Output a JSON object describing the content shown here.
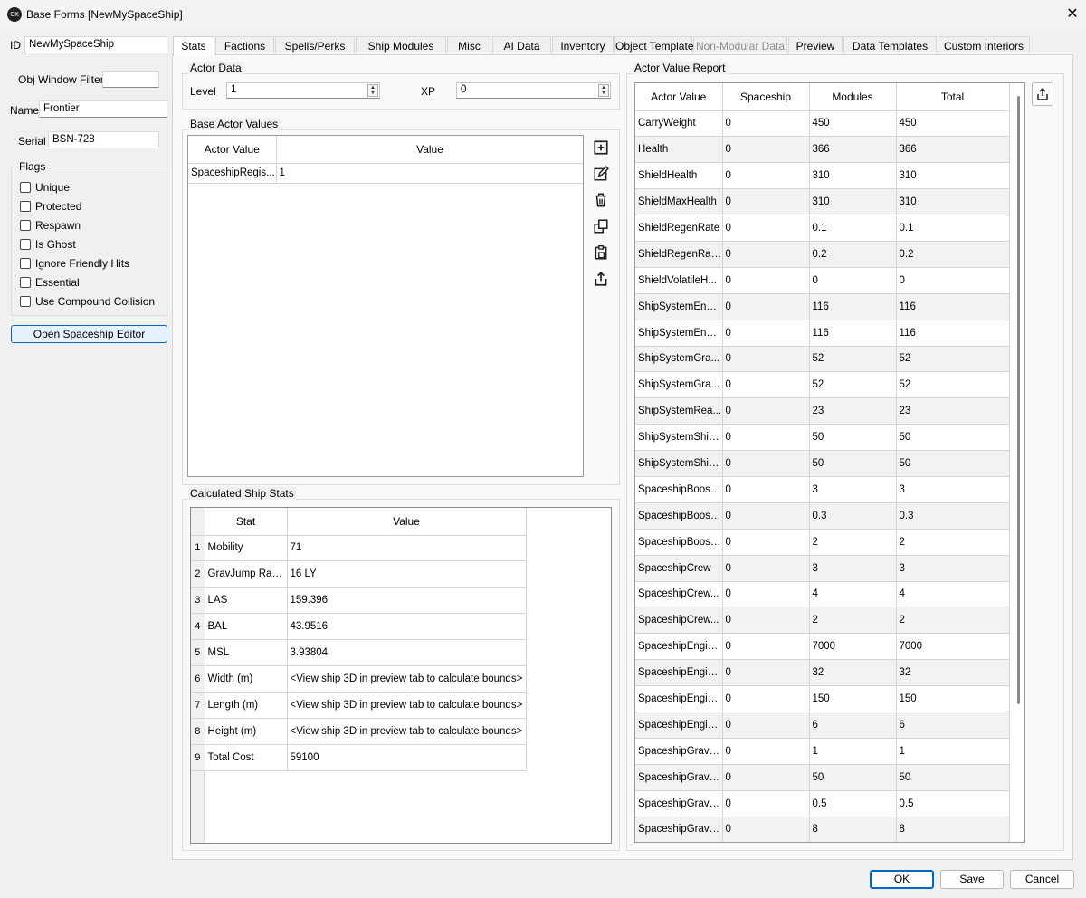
{
  "window": {
    "title": "Base Forms [NewMySpaceShip]",
    "app_icon": "CK",
    "close_glyph": "✕"
  },
  "left": {
    "id_label": "ID",
    "id_value": "NewMySpaceShip",
    "filter_label": "Obj Window Filter",
    "filter_value": "",
    "name_label": "Name",
    "name_value": "Frontier",
    "serial_label": "Serial",
    "serial_value": "BSN-728",
    "flags_title": "Flags",
    "flags": [
      {
        "label": "Unique",
        "checked": false
      },
      {
        "label": "Protected",
        "checked": false
      },
      {
        "label": "Respawn",
        "checked": false
      },
      {
        "label": "Is Ghost",
        "checked": false
      },
      {
        "label": "Ignore Friendly Hits",
        "checked": false
      },
      {
        "label": "Essential",
        "checked": false
      },
      {
        "label": "Use Compound Collision",
        "checked": false
      }
    ],
    "editor_button": "Open Spaceship Editor"
  },
  "tabs": [
    {
      "label": "Stats",
      "state": "active"
    },
    {
      "label": "Factions",
      "state": "normal"
    },
    {
      "label": "Spells/Perks",
      "state": "normal"
    },
    {
      "label": "Ship Modules",
      "state": "normal"
    },
    {
      "label": "Misc",
      "state": "normal"
    },
    {
      "label": "AI Data",
      "state": "normal"
    },
    {
      "label": "Inventory",
      "state": "normal"
    },
    {
      "label": "Object Template",
      "state": "normal"
    },
    {
      "label": "Non-Modular Data",
      "state": "disabled"
    },
    {
      "label": "Preview",
      "state": "normal"
    },
    {
      "label": "Data Templates",
      "state": "normal"
    },
    {
      "label": "Custom Interiors",
      "state": "normal"
    }
  ],
  "actor_data": {
    "title": "Actor Data",
    "level_label": "Level",
    "level_value": "1",
    "xp_label": "XP",
    "xp_value": "0"
  },
  "base_actor_values": {
    "title": "Base Actor Values",
    "columns": [
      "Actor Value",
      "Value"
    ],
    "rows": [
      {
        "actor_value": "SpaceshipRegis...",
        "value": "1"
      }
    ],
    "toolbar_icons": [
      "add-icon",
      "edit-icon",
      "delete-icon",
      "duplicate-icon",
      "paste-icon",
      "export-icon"
    ]
  },
  "calculated_ship_stats": {
    "title": "Calculated Ship Stats",
    "columns": [
      "Stat",
      "Value"
    ],
    "rows": [
      {
        "n": "1",
        "stat": "Mobility",
        "value": "71"
      },
      {
        "n": "2",
        "stat": "GravJump Range",
        "value": "16 LY"
      },
      {
        "n": "3",
        "stat": "LAS",
        "value": "159.396"
      },
      {
        "n": "4",
        "stat": "BAL",
        "value": "43.9516"
      },
      {
        "n": "5",
        "stat": "MSL",
        "value": "3.93804"
      },
      {
        "n": "6",
        "stat": "Width (m)",
        "value": "<View ship 3D in preview tab to calculate bounds>"
      },
      {
        "n": "7",
        "stat": "Length (m)",
        "value": "<View ship 3D in preview tab to calculate bounds>"
      },
      {
        "n": "8",
        "stat": "Height (m)",
        "value": "<View ship 3D in preview tab to calculate bounds>"
      },
      {
        "n": "9",
        "stat": "Total Cost",
        "value": "59100"
      }
    ]
  },
  "actor_value_report": {
    "title": "Actor Value Report",
    "columns": [
      "Actor Value",
      "Spaceship",
      "Modules",
      "Total"
    ],
    "rows": [
      [
        "CarryWeight",
        "0",
        "450",
        "450"
      ],
      [
        "Health",
        "0",
        "366",
        "366"
      ],
      [
        "ShieldHealth",
        "0",
        "310",
        "310"
      ],
      [
        "ShieldMaxHealth",
        "0",
        "310",
        "310"
      ],
      [
        "ShieldRegenRate",
        "0",
        "0.1",
        "0.1"
      ],
      [
        "ShieldRegenRat...",
        "0",
        "0.2",
        "0.2"
      ],
      [
        "ShieldVolatileH...",
        "0",
        "0",
        "0"
      ],
      [
        "ShipSystemEngi...",
        "0",
        "116",
        "116"
      ],
      [
        "ShipSystemEngi...",
        "0",
        "116",
        "116"
      ],
      [
        "ShipSystemGra...",
        "0",
        "52",
        "52"
      ],
      [
        "ShipSystemGra...",
        "0",
        "52",
        "52"
      ],
      [
        "ShipSystemRea...",
        "0",
        "23",
        "23"
      ],
      [
        "ShipSystemShie...",
        "0",
        "50",
        "50"
      ],
      [
        "ShipSystemShie...",
        "0",
        "50",
        "50"
      ],
      [
        "SpaceshipBoost...",
        "0",
        "3",
        "3"
      ],
      [
        "SpaceshipBoost...",
        "0",
        "0.3",
        "0.3"
      ],
      [
        "SpaceshipBoost...",
        "0",
        "2",
        "2"
      ],
      [
        "SpaceshipCrew",
        "0",
        "3",
        "3"
      ],
      [
        "SpaceshipCrew...",
        "0",
        "4",
        "4"
      ],
      [
        "SpaceshipCrew...",
        "0",
        "2",
        "2"
      ],
      [
        "SpaceshipEngin...",
        "0",
        "7000",
        "7000"
      ],
      [
        "SpaceshipEngin...",
        "0",
        "32",
        "32"
      ],
      [
        "SpaceshipEngin...",
        "0",
        "150",
        "150"
      ],
      [
        "SpaceshipEngin...",
        "0",
        "6",
        "6"
      ],
      [
        "SpaceshipGravJ...",
        "0",
        "1",
        "1"
      ],
      [
        "SpaceshipGravJ...",
        "0",
        "50",
        "50"
      ],
      [
        "SpaceshipGravJ...",
        "0",
        "0.5",
        "0.5"
      ],
      [
        "SpaceshipGravJ...",
        "0",
        "8",
        "8"
      ]
    ],
    "export_icon": "export-icon"
  },
  "footer": {
    "ok": "OK",
    "save": "Save",
    "cancel": "Cancel"
  }
}
